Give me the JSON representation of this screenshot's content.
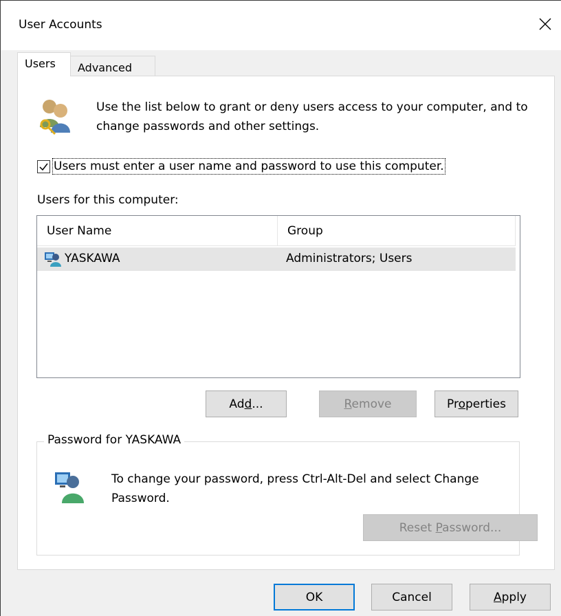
{
  "window": {
    "title": "User Accounts"
  },
  "tabs": [
    {
      "label": "Users",
      "active": true
    },
    {
      "label": "Advanced",
      "active": false
    }
  ],
  "intro": {
    "text": "Use the list below to grant or deny users access to your computer, and to change passwords and other settings."
  },
  "require_login": {
    "checked": true,
    "label": "Users must enter a user name and password to use this computer."
  },
  "users_list": {
    "title": "Users for this computer:",
    "columns": [
      "User Name",
      "Group"
    ],
    "rows": [
      {
        "user": "YASKAWA",
        "group": "Administrators; Users",
        "selected": true
      }
    ]
  },
  "list_buttons": {
    "add": "Add...",
    "remove": "Remove",
    "properties": "Properties"
  },
  "password_group": {
    "label": "Password for YASKAWA",
    "text": "To change your password, press Ctrl-Alt-Del and select Change Password.",
    "reset_button": "Reset Password..."
  },
  "footer": {
    "ok": "OK",
    "cancel": "Cancel",
    "apply": "Apply"
  },
  "colors": {
    "default_button_border": "#0078d7",
    "selected_row": "#e5e5e5"
  }
}
